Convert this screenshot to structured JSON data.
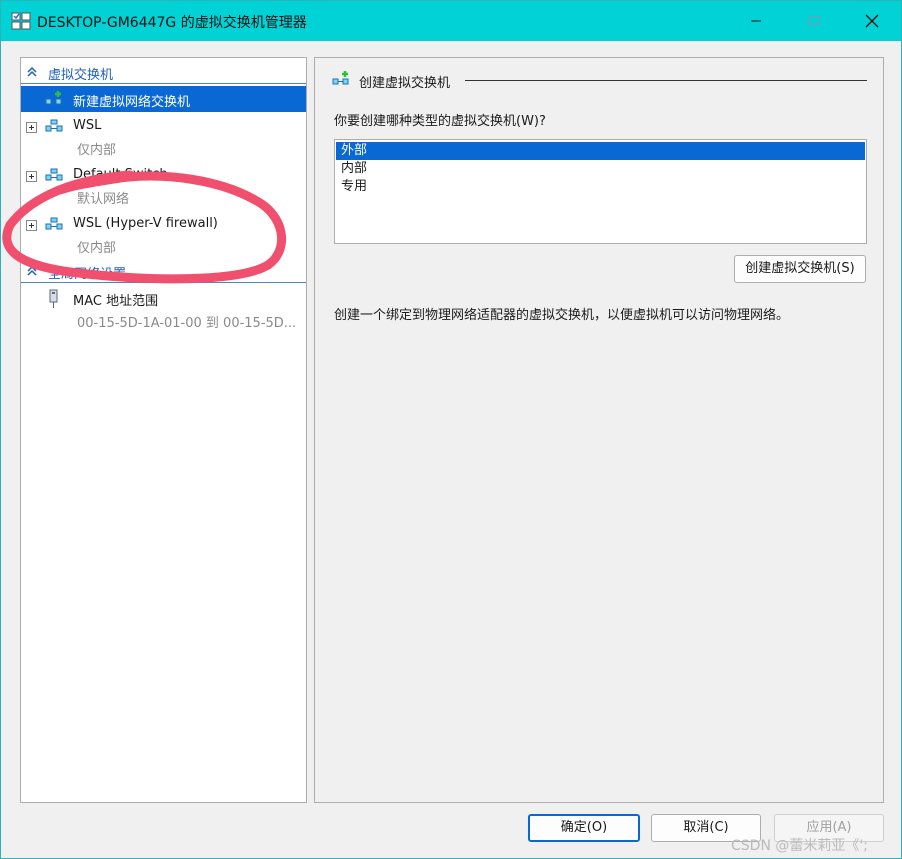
{
  "window": {
    "title": "DESKTOP-GM6447G 的虚拟交换机管理器",
    "app_icon": "virtual-switch-manager-icon",
    "controls": [
      "minimize",
      "maximize",
      "close"
    ]
  },
  "sidebar": {
    "virtual_switches_header": "虚拟交换机",
    "items": [
      {
        "name": "新建虚拟网络交换机",
        "selected": true
      },
      {
        "name": "WSL",
        "sub": "仅内部"
      },
      {
        "name": "Default Switch",
        "sub": "默认网络"
      },
      {
        "name": "WSL (Hyper-V firewall)",
        "sub": "仅内部"
      }
    ],
    "global_header": "全局网络设置",
    "global_items": [
      {
        "name": "MAC 地址范围",
        "sub": "00-15-5D-1A-01-00 到 00-15-5D..."
      }
    ]
  },
  "main": {
    "group_title": "创建虚拟交换机",
    "question": "你要创建哪种类型的虚拟交换机(W)?",
    "switch_types": [
      "外部",
      "内部",
      "专用"
    ],
    "selected_type": "外部",
    "create_button": "创建虚拟交换机(S)",
    "description": "创建一个绑定到物理网络适配器的虚拟交换机，以便虚拟机可以访问物理网络。"
  },
  "footer": {
    "ok": "确定(O)",
    "cancel": "取消(C)",
    "apply": "应用(A)"
  },
  "watermark": "CSDN @蕾米莉亚《';",
  "colors": {
    "titlebar": "#00d2d6",
    "selection": "#0a68d4",
    "annotation": "#f0506e"
  }
}
